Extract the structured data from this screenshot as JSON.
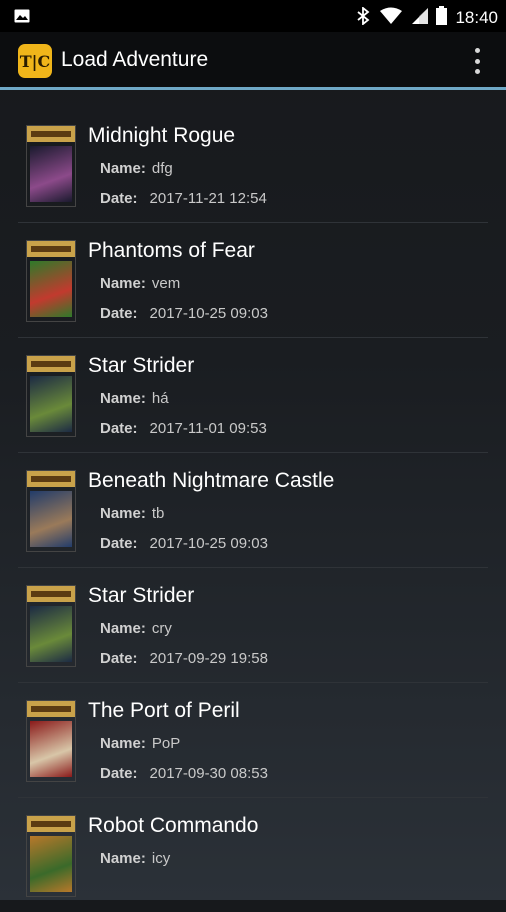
{
  "status_bar": {
    "time": "18:40"
  },
  "app_bar": {
    "logo_text": "T|C",
    "title": "Load Adventure"
  },
  "labels": {
    "name": "Name:",
    "date": "Date:"
  },
  "saves": [
    {
      "title": "Midnight Rogue",
      "name": "dfg",
      "date": "2017-11-21 12:54",
      "cover_colors": [
        "#1a1a2e",
        "#8c4a8a"
      ]
    },
    {
      "title": "Phantoms of Fear",
      "name": "vem",
      "date": "2017-10-25 09:03",
      "cover_colors": [
        "#2e7a2a",
        "#c23a2e"
      ]
    },
    {
      "title": "Star Strider",
      "name": "há",
      "date": "2017-11-01 09:53",
      "cover_colors": [
        "#1c2a44",
        "#6a8a3a"
      ]
    },
    {
      "title": "Beneath Nightmare Castle",
      "name": "tb",
      "date": "2017-10-25 09:03",
      "cover_colors": [
        "#223c6a",
        "#9a7a5a"
      ]
    },
    {
      "title": "Star Strider",
      "name": "cry",
      "date": "2017-09-29 19:58",
      "cover_colors": [
        "#1c2a44",
        "#6a8a3a"
      ]
    },
    {
      "title": "The Port of Peril",
      "name": "PoP",
      "date": "2017-09-30 08:53",
      "cover_colors": [
        "#8a1a1a",
        "#d8c6a8"
      ]
    },
    {
      "title": "Robot Commando",
      "name": "icy",
      "date": "",
      "cover_colors": [
        "#b8782a",
        "#3a6a2a"
      ]
    }
  ]
}
